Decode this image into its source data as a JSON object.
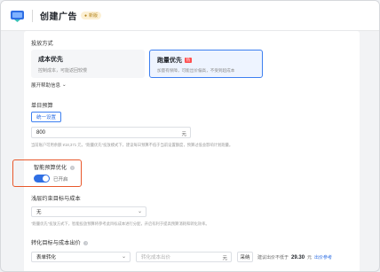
{
  "header": {
    "title": "创建广告",
    "badge": "新版"
  },
  "delivery_mode": {
    "label": "投放方式",
    "options": [
      {
        "title": "成本优先",
        "desc": "控制成本，可能返回较慢",
        "selected": false
      },
      {
        "title": "跑量优先",
        "tag": "热",
        "desc": "加量有保障，可能出价偏高，不受到超成本",
        "selected": true
      }
    ],
    "help_link": "展开帮助信息"
  },
  "daily_budget": {
    "label": "单日预算",
    "button": "统一设置",
    "value": "800",
    "unit": "元",
    "hint": "当前账户可用余额 ¥18,371 元，\"跑量优先\"投放模式下，建议每日预算不低于当前设置额度，预算过低会影响计划跑量。"
  },
  "smart_budget": {
    "label": "智能预算优化",
    "help_icon": "?",
    "toggle_label": "已开启",
    "enabled": true
  },
  "shallow_goal": {
    "label": "浅层约束目标与成本",
    "select_value": "无",
    "hint": "\"跑量优先\"投放方式下，智能投放预算将参考此目标成本进行分配，开启有利于提高预算消耗和转化效率。"
  },
  "conversion_goal": {
    "label": "转化目标与成本出价",
    "help_icon": "?",
    "select_value": "表单转化",
    "cost_placeholder": "转化成本出价",
    "unit": "元",
    "button": "采纳",
    "recommend_label": "建议出价不低于",
    "recommend_value": "29.30",
    "recommend_unit": "元",
    "recommend_link": "出价参考"
  }
}
